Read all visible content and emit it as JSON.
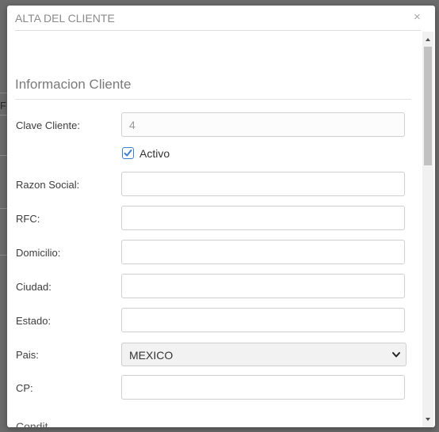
{
  "modal": {
    "title": "ALTA DEL CLIENTE",
    "close_glyph": "×"
  },
  "background": {
    "partial_glyph": "F"
  },
  "section": {
    "title": "Informacion Cliente"
  },
  "form": {
    "clave_label": "Clave Cliente:",
    "clave_value": "4",
    "activo_label": "Activo",
    "activo_checked": true,
    "razon_label": "Razon Social:",
    "razon_value": "",
    "rfc_label": "RFC:",
    "rfc_value": "",
    "domicilio_label": "Domicilio:",
    "domicilio_value": "",
    "ciudad_label": "Ciudad:",
    "ciudad_value": "",
    "estado_label": "Estado:",
    "estado_value": "",
    "pais_label": "Pais:",
    "pais_selected": "MEXICO",
    "cp_label": "CP:",
    "cp_value": "",
    "next_label_partial": "Condit"
  },
  "colors": {
    "checkbox_accent": "#3b7fd0",
    "overlay": "#5a5a5a"
  },
  "icons": {
    "close": "close-icon",
    "check": "check-icon",
    "select": "chevron-down-icon"
  }
}
